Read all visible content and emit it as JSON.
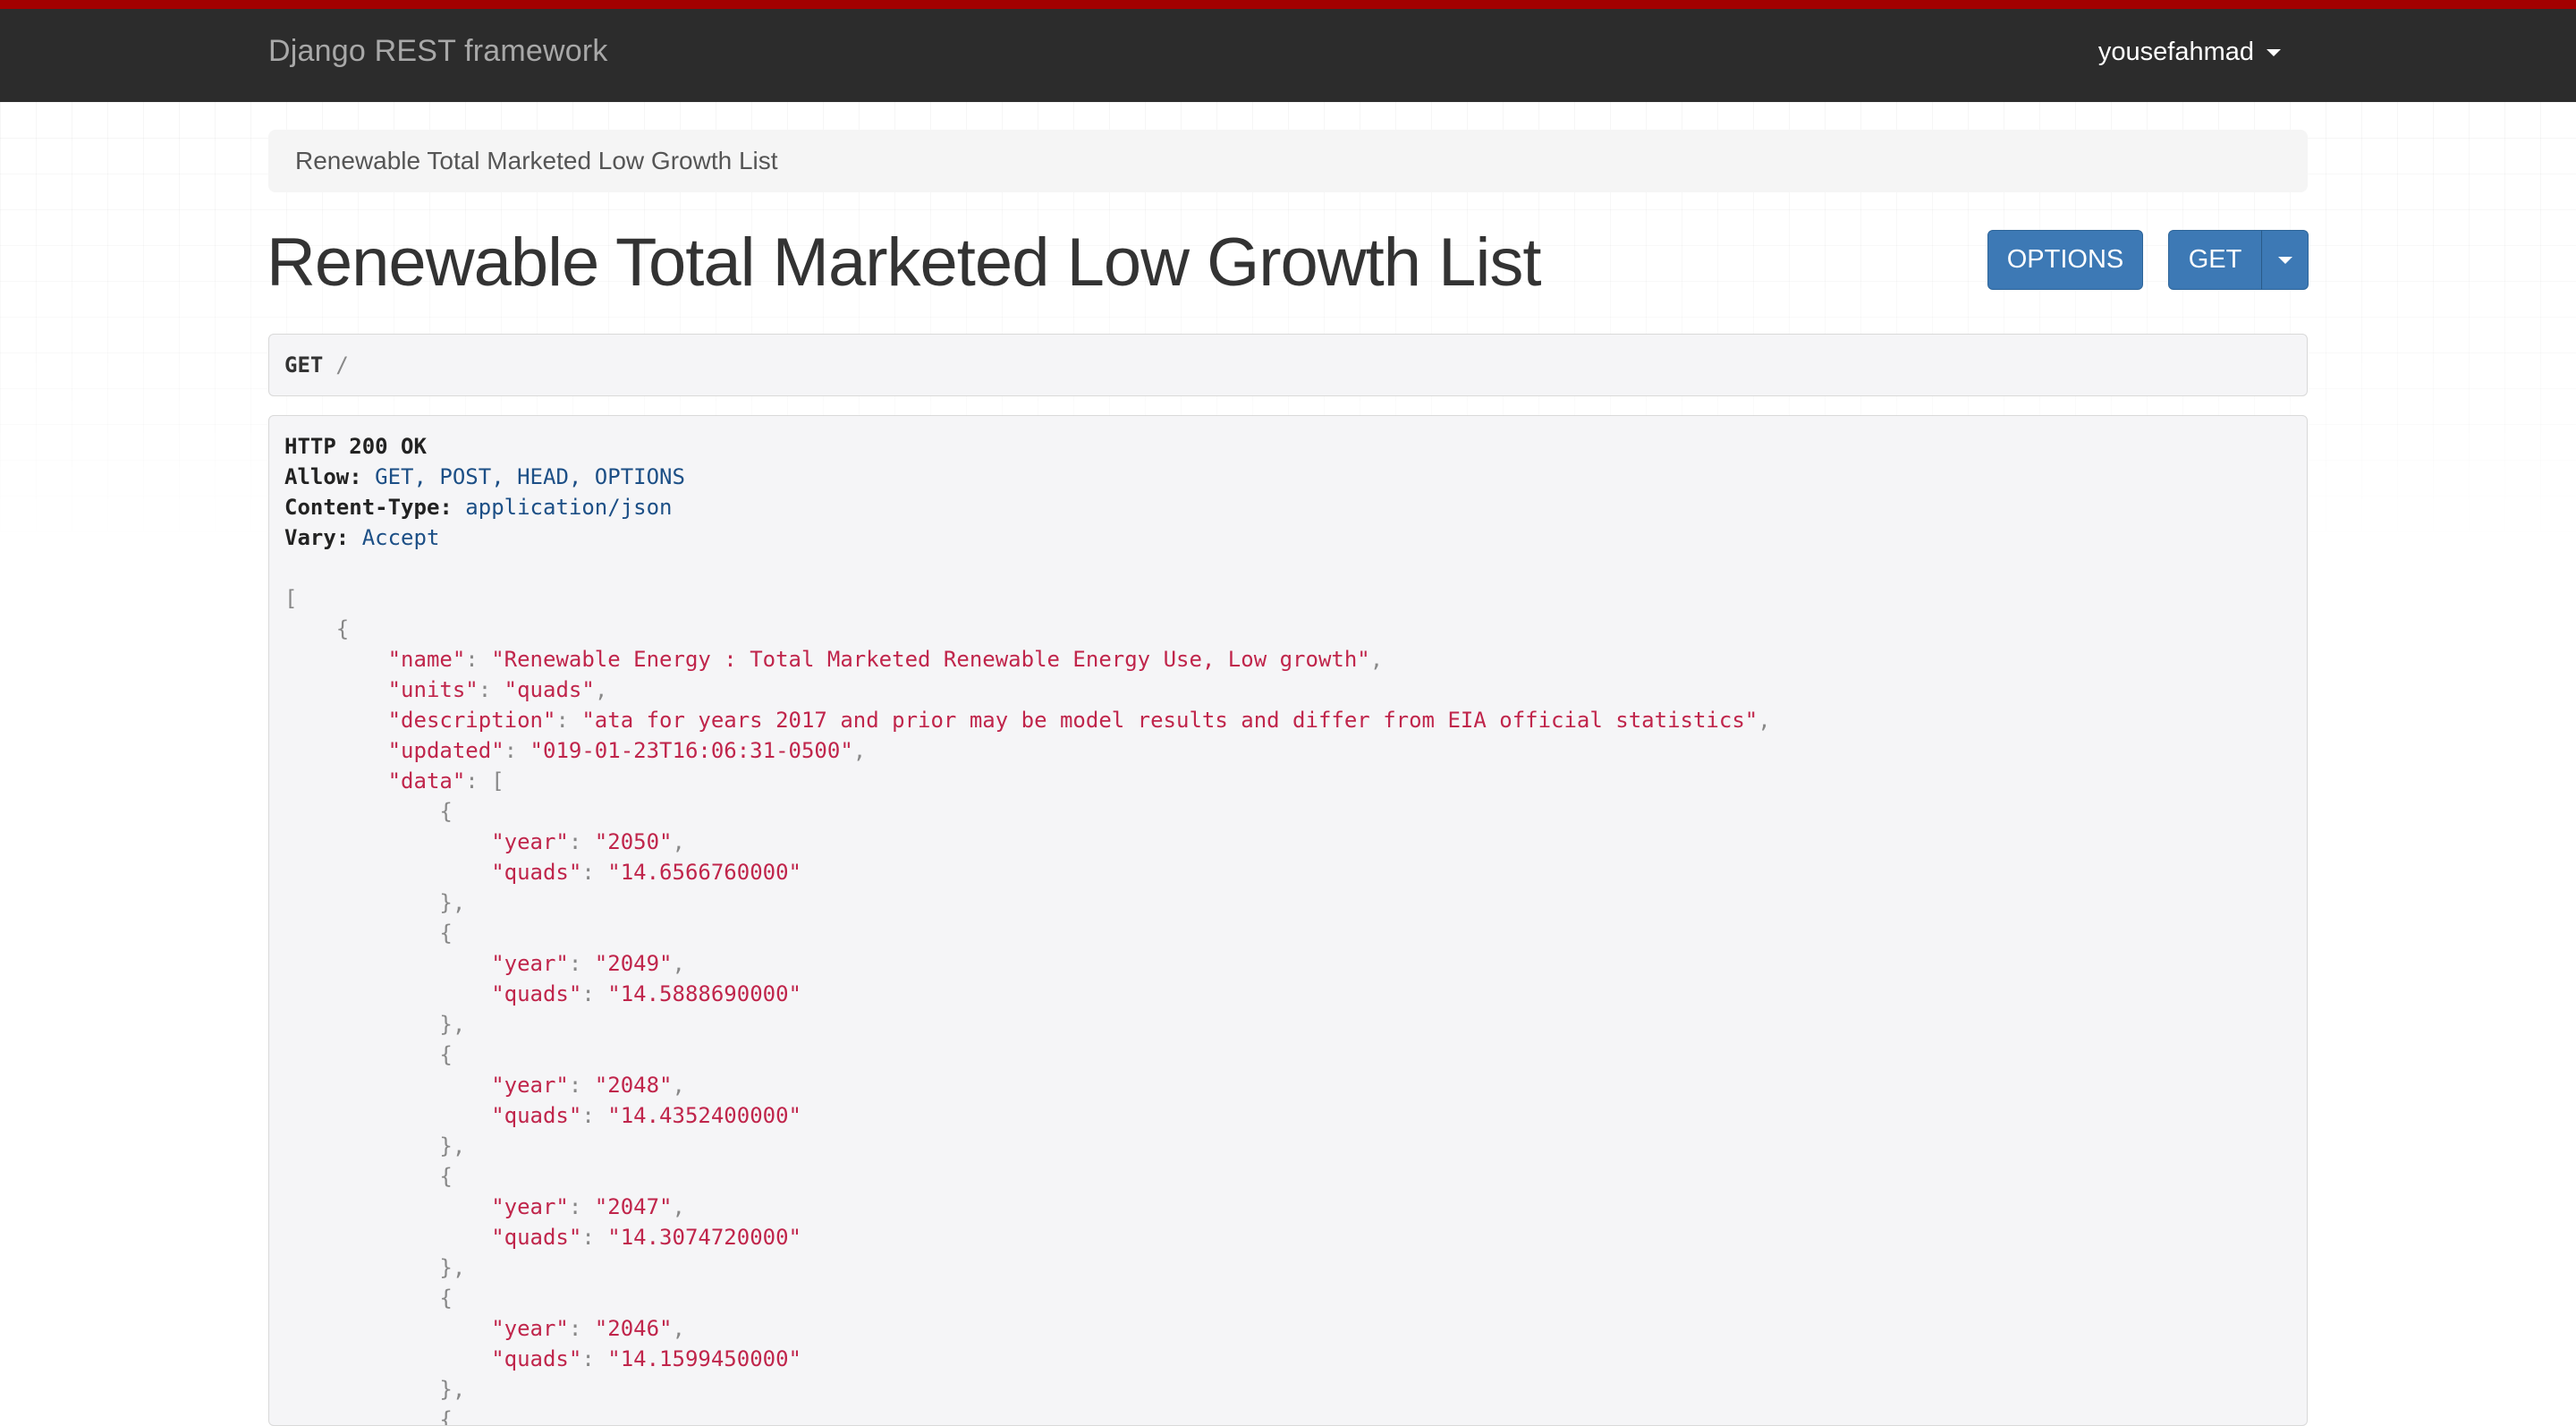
{
  "navbar": {
    "brand": "Django REST framework",
    "user": "yousefahmad"
  },
  "breadcrumb": {
    "label": "Renewable Total Marketed Low Growth List"
  },
  "page": {
    "title": "Renewable Total Marketed Low Growth List"
  },
  "actions": {
    "options_label": "OPTIONS",
    "get_label": "GET"
  },
  "request": {
    "method": "GET",
    "path": "/"
  },
  "response": {
    "status": "HTTP 200 OK",
    "headers": [
      {
        "key": "Allow:",
        "value": "GET, POST, HEAD, OPTIONS"
      },
      {
        "key": "Content-Type:",
        "value": "application/json"
      },
      {
        "key": "Vary:",
        "value": "Accept"
      }
    ],
    "body": {
      "name_key": "\"name\"",
      "name_value": "\"Renewable Energy : Total Marketed Renewable Energy Use, Low growth\"",
      "units_key": "\"units\"",
      "units_value": "\"quads\"",
      "description_key": "\"description\"",
      "description_value": "\"ata for years 2017 and prior may be model results and differ from EIA official statistics\"",
      "updated_key": "\"updated\"",
      "updated_value": "\"019-01-23T16:06:31-0500\"",
      "data_key": "\"data\"",
      "year_key": "\"year\"",
      "quads_key": "\"quads\"",
      "data": [
        {
          "year": "\"2050\"",
          "quads": "\"14.6566760000\""
        },
        {
          "year": "\"2049\"",
          "quads": "\"14.5888690000\""
        },
        {
          "year": "\"2048\"",
          "quads": "\"14.4352400000\""
        },
        {
          "year": "\"2047\"",
          "quads": "\"14.3074720000\""
        },
        {
          "year": "\"2046\"",
          "quads": "\"14.1599450000\""
        }
      ]
    }
  }
}
